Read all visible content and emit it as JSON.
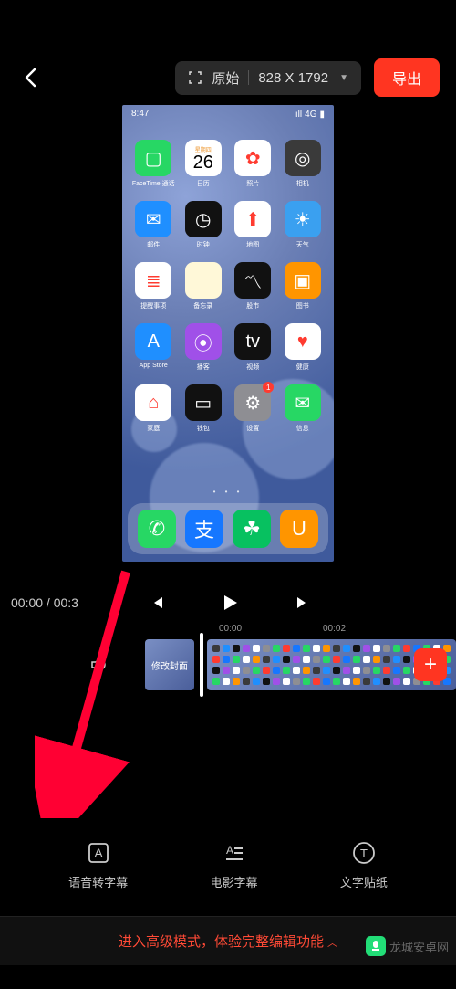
{
  "toolbar": {
    "aspect_label": "原始",
    "resolution": "828 X 1792",
    "export_label": "导出"
  },
  "preview": {
    "phone_status": {
      "time": "8:47",
      "signal": "4G"
    },
    "calendar": {
      "weekday": "星期四",
      "day": "26"
    },
    "apps": [
      {
        "label": "FaceTime 通话",
        "bg": "#27d764",
        "glyph": "▢"
      },
      {
        "label": "日历",
        "bg": "#ffffff",
        "glyph": ""
      },
      {
        "label": "照片",
        "bg": "#ffffff",
        "glyph": "✿"
      },
      {
        "label": "相机",
        "bg": "#3a3a3a",
        "glyph": "◎"
      },
      {
        "label": "邮件",
        "bg": "#1f8fff",
        "glyph": "✉"
      },
      {
        "label": "时钟",
        "bg": "#111111",
        "glyph": "◷"
      },
      {
        "label": "地图",
        "bg": "#ffffff",
        "glyph": "⬆"
      },
      {
        "label": "天气",
        "bg": "#3aa0f0",
        "glyph": "☀"
      },
      {
        "label": "提醒事项",
        "bg": "#ffffff",
        "glyph": "≣"
      },
      {
        "label": "备忘录",
        "bg": "#fff8d8",
        "glyph": ""
      },
      {
        "label": "股市",
        "bg": "#111111",
        "glyph": "〽"
      },
      {
        "label": "图书",
        "bg": "#ff9500",
        "glyph": "▣"
      },
      {
        "label": "App Store",
        "bg": "#1f8fff",
        "glyph": "A"
      },
      {
        "label": "播客",
        "bg": "#a050e8",
        "glyph": "⦿"
      },
      {
        "label": "视频",
        "bg": "#111111",
        "glyph": "tv"
      },
      {
        "label": "健康",
        "bg": "#ffffff",
        "glyph": "♥"
      },
      {
        "label": "家庭",
        "bg": "#ffffff",
        "glyph": "⌂"
      },
      {
        "label": "钱包",
        "bg": "#111111",
        "glyph": "▭"
      },
      {
        "label": "设置",
        "bg": "#8e8e93",
        "glyph": "⚙",
        "badge": "1"
      },
      {
        "label": "信息",
        "bg": "#27d764",
        "glyph": "✉"
      }
    ],
    "dock": [
      {
        "name": "phone",
        "bg": "#27d764",
        "glyph": "✆"
      },
      {
        "name": "alipay",
        "bg": "#1677ff",
        "glyph": "支"
      },
      {
        "name": "wechat",
        "bg": "#07c160",
        "glyph": "☘"
      },
      {
        "name": "uc",
        "bg": "#ff9500",
        "glyph": "U"
      }
    ]
  },
  "playback": {
    "current": "00:00",
    "total": "00:3"
  },
  "timeline": {
    "ticks": [
      "00:00",
      "00:02"
    ],
    "cover_label": "修改封面"
  },
  "tools": [
    {
      "key": "voice-subtitle",
      "label": "语音转字幕"
    },
    {
      "key": "movie-subtitle",
      "label": "电影字幕"
    },
    {
      "key": "text-sticker",
      "label": "文字贴纸"
    }
  ],
  "advanced": {
    "text": "进入高级模式，体验完整编辑功能"
  },
  "watermark": {
    "text": "龙城安卓网"
  }
}
